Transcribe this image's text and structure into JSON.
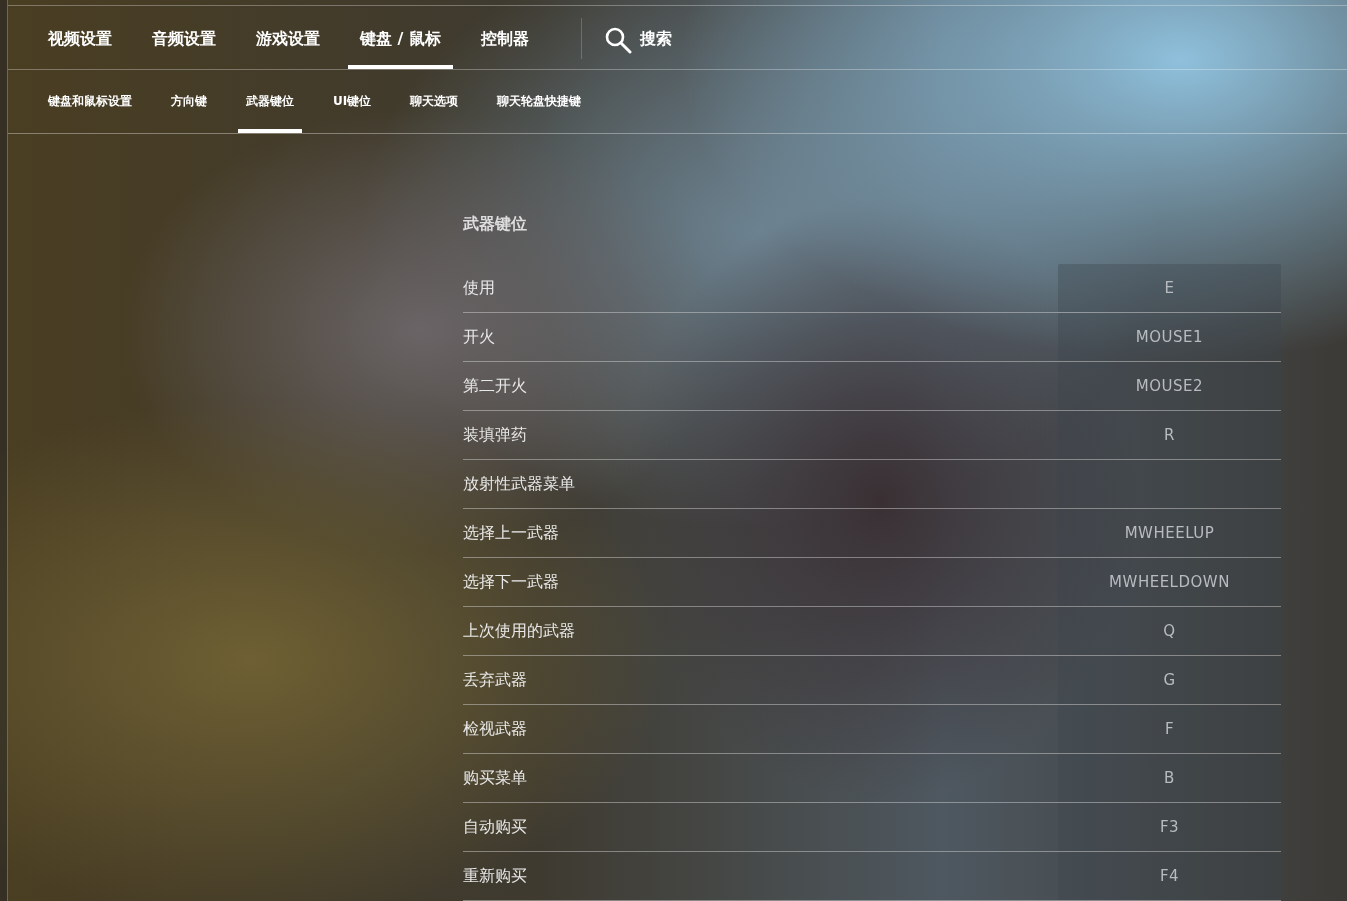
{
  "main_tabs": [
    {
      "label": "视频设置",
      "selected": false
    },
    {
      "label": "音频设置",
      "selected": false
    },
    {
      "label": "游戏设置",
      "selected": false
    },
    {
      "label": "键盘 / 鼠标",
      "selected": true
    },
    {
      "label": "控制器",
      "selected": false
    }
  ],
  "search": {
    "label": "搜索"
  },
  "sub_tabs": [
    {
      "label": "键盘和鼠标设置",
      "selected": false
    },
    {
      "label": "方向键",
      "selected": false
    },
    {
      "label": "武器键位",
      "selected": true
    },
    {
      "label": "UI键位",
      "selected": false
    },
    {
      "label": "聊天选项",
      "selected": false
    },
    {
      "label": "聊天轮盘快捷键",
      "selected": false
    }
  ],
  "section": {
    "title": "武器键位",
    "rows": [
      {
        "label": "使用",
        "key": "E"
      },
      {
        "label": "开火",
        "key": "MOUSE1"
      },
      {
        "label": "第二开火",
        "key": "MOUSE2"
      },
      {
        "label": "装填弹药",
        "key": "R"
      },
      {
        "label": "放射性武器菜单"
      },
      {
        "label": "选择上一武器",
        "key": "MWHEELUP"
      },
      {
        "label": "选择下一武器",
        "key": "MWHEELDOWN"
      },
      {
        "label": "上次使用的武器",
        "key": "Q"
      },
      {
        "label": "丢弃武器",
        "key": "G"
      },
      {
        "label": "检视武器",
        "key": "F"
      },
      {
        "label": "购买菜单",
        "key": "B"
      },
      {
        "label": "自动购买",
        "key": "F3"
      },
      {
        "label": "重新购买",
        "key": "F4"
      }
    ]
  }
}
